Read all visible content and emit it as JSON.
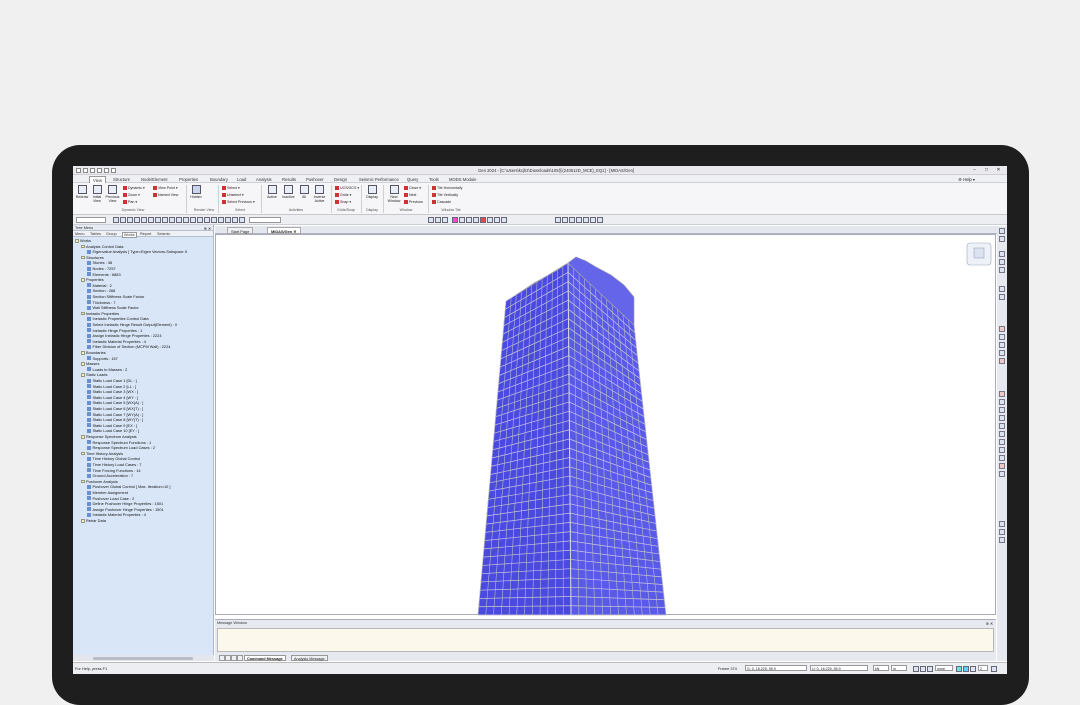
{
  "window": {
    "title": "Gen 2024 - [C:\\Users\\kcjh2\\Downloads\\105동(240612D_MCE)_EQ1] - [MIDAS/Gen]",
    "quick_access": [
      "new",
      "open",
      "save",
      "undo",
      "redo"
    ],
    "controls": [
      "–",
      "□",
      "✕"
    ]
  },
  "menubar": {
    "items": [
      "View",
      "Structure",
      "Node/Element",
      "Properties",
      "Boundary",
      "Load",
      "Analysis",
      "Results",
      "Pushover",
      "Design",
      "Seismic Performance",
      "Query",
      "Tools",
      "MODS Module"
    ],
    "active": "View",
    "help": "Help"
  },
  "ribbon": {
    "groups": [
      {
        "name": "Dynamic View",
        "buttons": [
          "Redraw",
          "Initial View",
          "Previous View"
        ],
        "small": [
          "Dynamic",
          "Zoom",
          "Pan",
          "View Point",
          "Named View"
        ]
      },
      {
        "name": "Render View",
        "buttons": [
          "Hidden"
        ],
        "small": []
      },
      {
        "name": "Select",
        "buttons": [],
        "small": [
          "Select",
          "Unselect",
          "Select Previous"
        ]
      },
      {
        "name": "Activities",
        "buttons": [
          "Active",
          "Inactive",
          "All",
          "Inverse Active"
        ],
        "small": []
      },
      {
        "name": "Grids/Snap",
        "buttons": [],
        "small": [
          "UCS/GCS",
          "Grids",
          "Snap"
        ]
      },
      {
        "name": "Display",
        "buttons": [
          "Display"
        ],
        "small": []
      },
      {
        "name": "Window",
        "buttons": [
          "New Window"
        ],
        "small": [
          "Close",
          "Next",
          "Previous"
        ]
      },
      {
        "name": "Window Tile",
        "buttons": [],
        "small": [
          "Tile Horizontally",
          "Tile Vertically",
          "Cascade"
        ]
      }
    ]
  },
  "tree": {
    "title": "Tree Menu",
    "tabs": [
      "Menu",
      "Tables",
      "Group",
      "Works",
      "Report",
      "Seismic"
    ],
    "active_tab": "Works",
    "items": [
      {
        "text": "Works",
        "level": 0,
        "hdr": true
      },
      {
        "text": "Analysis Control Data",
        "level": 1,
        "hdr": true
      },
      {
        "text": "Eigenvalue Analysis [ Type=Eigen Vectors-Subspace It",
        "level": 2
      },
      {
        "text": "Structures",
        "level": 1,
        "hdr": true
      },
      {
        "text": "Stories : 38",
        "level": 2
      },
      {
        "text": "Nodes : 7257",
        "level": 2
      },
      {
        "text": "Elements : 6883",
        "level": 2
      },
      {
        "text": "Properties",
        "level": 1,
        "hdr": true
      },
      {
        "text": "Material : 2",
        "level": 2
      },
      {
        "text": "Section : 268",
        "level": 2
      },
      {
        "text": "Section Stiffness Scale Factor",
        "level": 2
      },
      {
        "text": "Thickness : 7",
        "level": 2
      },
      {
        "text": "Wall Stiffness Scale Factor",
        "level": 2
      },
      {
        "text": "Inelastic Properties",
        "level": 1,
        "hdr": true
      },
      {
        "text": "Inelastic Properties Control Data",
        "level": 2
      },
      {
        "text": "Select Inelastic Hinge Result Output(Element) : 0",
        "level": 2
      },
      {
        "text": "Inelastic Hinge Properties : 1",
        "level": 2
      },
      {
        "text": "Assign Inelastic Hinge Properties : 2224",
        "level": 2
      },
      {
        "text": "Inelastic Material Properties : 4",
        "level": 2
      },
      {
        "text": "Fiber Division of Section (MCPM Wall) : 2224",
        "level": 2
      },
      {
        "text": "Boundaries",
        "level": 1,
        "hdr": true
      },
      {
        "text": "Supports : 157",
        "level": 2
      },
      {
        "text": "Masses",
        "level": 1,
        "hdr": true
      },
      {
        "text": "Loads to Masses : 2",
        "level": 2
      },
      {
        "text": "Static Loads",
        "level": 1,
        "hdr": true
      },
      {
        "text": "Static Load Case 1 [DL : ]",
        "level": 2
      },
      {
        "text": "Static Load Case 2 [LL : ]",
        "level": 2
      },
      {
        "text": "Static Load Case 3 [WX : ]",
        "level": 2
      },
      {
        "text": "Static Load Case 4 [WY : ]",
        "level": 2
      },
      {
        "text": "Static Load Case 5 [WX(A) : ]",
        "level": 2
      },
      {
        "text": "Static Load Case 6 [WX(T) : ]",
        "level": 2
      },
      {
        "text": "Static Load Case 7 [WY(A) : ]",
        "level": 2
      },
      {
        "text": "Static Load Case 8 [WY(T) : ]",
        "level": 2
      },
      {
        "text": "Static Load Case 9 [EX : ]",
        "level": 2
      },
      {
        "text": "Static Load Case 10 [EY : ]",
        "level": 2
      },
      {
        "text": "Response Spectrum Analysis",
        "level": 1,
        "hdr": true
      },
      {
        "text": "Response Spectrum Functions : 1",
        "level": 2
      },
      {
        "text": "Response Spectrum Load Cases : 2",
        "level": 2
      },
      {
        "text": "Time History Analysis",
        "level": 1,
        "hdr": true
      },
      {
        "text": "Time History Global Control",
        "level": 2
      },
      {
        "text": "Time History Load Cases : 7",
        "level": 2
      },
      {
        "text": "Time Forcing Functions : 14",
        "level": 2
      },
      {
        "text": "Ground Acceleration : 7",
        "level": 2
      },
      {
        "text": "Pushover Analysis",
        "level": 1,
        "hdr": true
      },
      {
        "text": "Pushover Global Control [ Max. Iteration=10 ]",
        "level": 2
      },
      {
        "text": "Member Assignment",
        "level": 2
      },
      {
        "text": "Pushover Load Case : 2",
        "level": 2
      },
      {
        "text": "Define Pushover Hinge Properties : 1501",
        "level": 2
      },
      {
        "text": "Assign Pushover Hinge Properties : 1501",
        "level": 2
      },
      {
        "text": "Inelastic Material Properties : 4",
        "level": 2
      },
      {
        "text": "Rebar Data",
        "level": 1,
        "hdr": true
      }
    ]
  },
  "doc_tabs": [
    "Start Page",
    "MIDAS/Gen"
  ],
  "active_doc": "MIDAS/Gen",
  "model": {
    "color": "#4a4ae0",
    "frame": "#9a9aa6"
  },
  "message": {
    "title": "Message Window",
    "tabs": [
      "Command Message",
      "Analysis Message"
    ]
  },
  "status": {
    "help": "For Help, press F1",
    "frame": "Frame 374",
    "g_coord": "G: 0, 18.225, 55.9",
    "u_coord": "U: 0, 18.225, 55.9",
    "unit_force": "kN",
    "unit_len": "m",
    "filter": "none",
    "number": "2"
  }
}
